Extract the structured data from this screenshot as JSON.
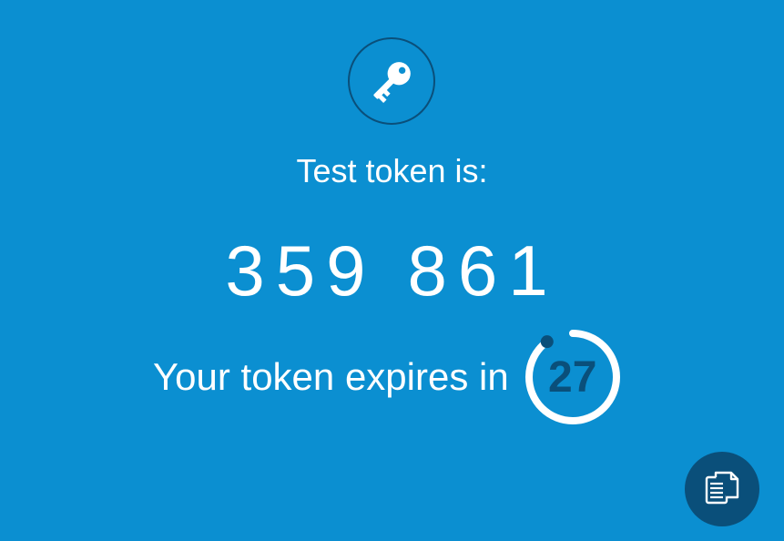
{
  "header": {
    "icon": "key-icon"
  },
  "token": {
    "label": "Test token is:",
    "part1": "359",
    "part2": "861"
  },
  "expiry": {
    "prefix": "Your token expires in",
    "seconds": "27",
    "seconds_total": 30
  },
  "actions": {
    "copy_icon": "copy-icon"
  },
  "colors": {
    "background": "#0b8fd1",
    "accent_dark": "#0a4f7a",
    "foreground": "#ffffff"
  }
}
